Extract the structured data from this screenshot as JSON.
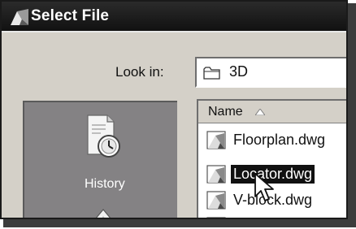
{
  "window": {
    "title": "Select File"
  },
  "look_in": {
    "label": "Look in:",
    "value": "3D",
    "icon": "folder-icon"
  },
  "places": {
    "items": [
      {
        "label": "History",
        "icon": "history-icon"
      }
    ]
  },
  "file_list": {
    "column_header": "Name",
    "sort": "ascending",
    "files": [
      {
        "name": "Floorplan.dwg",
        "selected": false,
        "icon": "dwg-file-icon"
      },
      {
        "name": "Locator.dwg",
        "selected": true,
        "icon": "dwg-file-icon"
      },
      {
        "name": "V-block.dwg",
        "selected": false,
        "icon": "dwg-file-icon"
      }
    ]
  },
  "colors": {
    "titlebar": "#111111",
    "dialog_background": "#d4d0c8",
    "places_background": "#848284",
    "selection": "#111111"
  }
}
